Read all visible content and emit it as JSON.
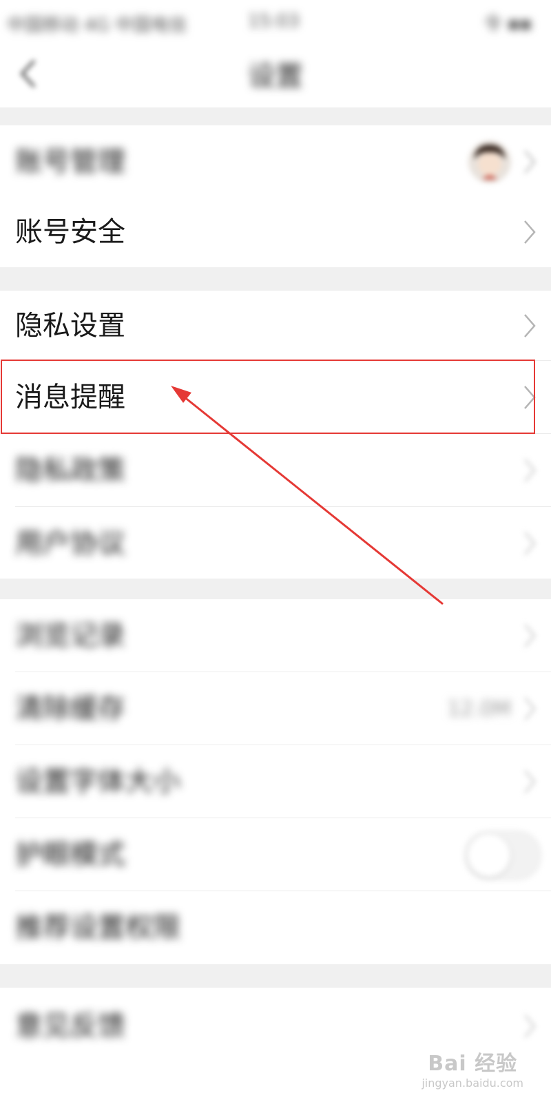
{
  "status_bar": {
    "carrier": "中国移动 4G 中国电信",
    "time": "15:03",
    "indicators": "令 ▪▪"
  },
  "nav": {
    "title": "设置",
    "back_icon": "chevron-left-icon"
  },
  "sections": {
    "account": {
      "account_management_label": "账号管理",
      "account_security_label": "账号安全"
    },
    "privacy": {
      "privacy_settings_label": "隐私设置",
      "message_reminder_label": "消息提醒",
      "privacy_policy_label": "隐私政策",
      "user_agreement_label": "用户协议"
    },
    "general": {
      "browse_history_label": "浏览记录",
      "clear_cache_label": "清除缓存",
      "clear_cache_value": "12.0M",
      "font_size_label": "设置字体大小",
      "eye_care_label": "护眼模式",
      "eye_care_on": false,
      "recommendation_label": "推荐设置权限"
    },
    "about": {
      "feedback_label": "意见反馈"
    }
  },
  "annotation": {
    "highlight_color": "#e53935"
  },
  "watermark": {
    "main": "Bai 经验",
    "sub": "jingyan.baidu.com"
  }
}
